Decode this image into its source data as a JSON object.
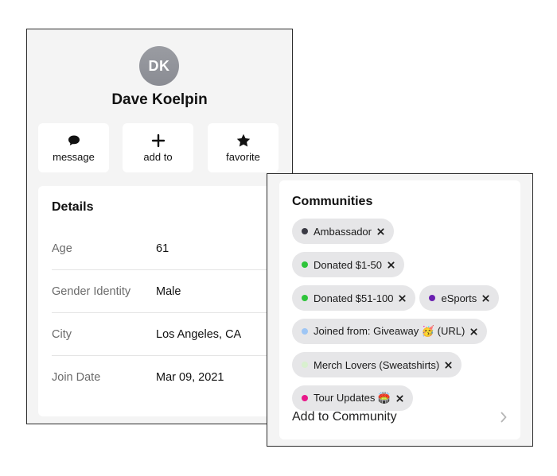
{
  "profile": {
    "initials": "DK",
    "name": "Dave Koelpin",
    "actions": [
      {
        "label": "message",
        "icon": "chat-bubble-icon"
      },
      {
        "label": "add to",
        "icon": "plus-icon"
      },
      {
        "label": "favorite",
        "icon": "star-icon"
      }
    ]
  },
  "details": {
    "title": "Details",
    "rows": [
      {
        "label": "Age",
        "value": "61"
      },
      {
        "label": "Gender Identity",
        "value": "Male"
      },
      {
        "label": "City",
        "value": "Los Angeles, CA"
      },
      {
        "label": "Join Date",
        "value": "Mar 09, 2021"
      }
    ]
  },
  "communities": {
    "title": "Communities",
    "chips": [
      {
        "label": "Ambassador",
        "dot_color": "#3a3a44"
      },
      {
        "label": "Donated $1-50",
        "dot_color": "#2ec43a"
      },
      {
        "label": "Donated $51-100",
        "dot_color": "#2ec43a"
      },
      {
        "label": "eSports",
        "dot_color": "#6a1fb0"
      },
      {
        "label": "Joined from: Giveaway 🥳 (URL)",
        "dot_color": "#9ec6f5"
      },
      {
        "label": "Merch Lovers (Sweatshirts)",
        "dot_color": "#d8f0cf"
      },
      {
        "label": "Tour Updates 🏟️",
        "dot_color": "#e8188a"
      }
    ],
    "add_label": "Add to Community"
  },
  "colors": {
    "chip_bg": "#e6e6e8",
    "panel_bg": "#f4f4f4",
    "avatar_bg": "#9a9ca2"
  }
}
